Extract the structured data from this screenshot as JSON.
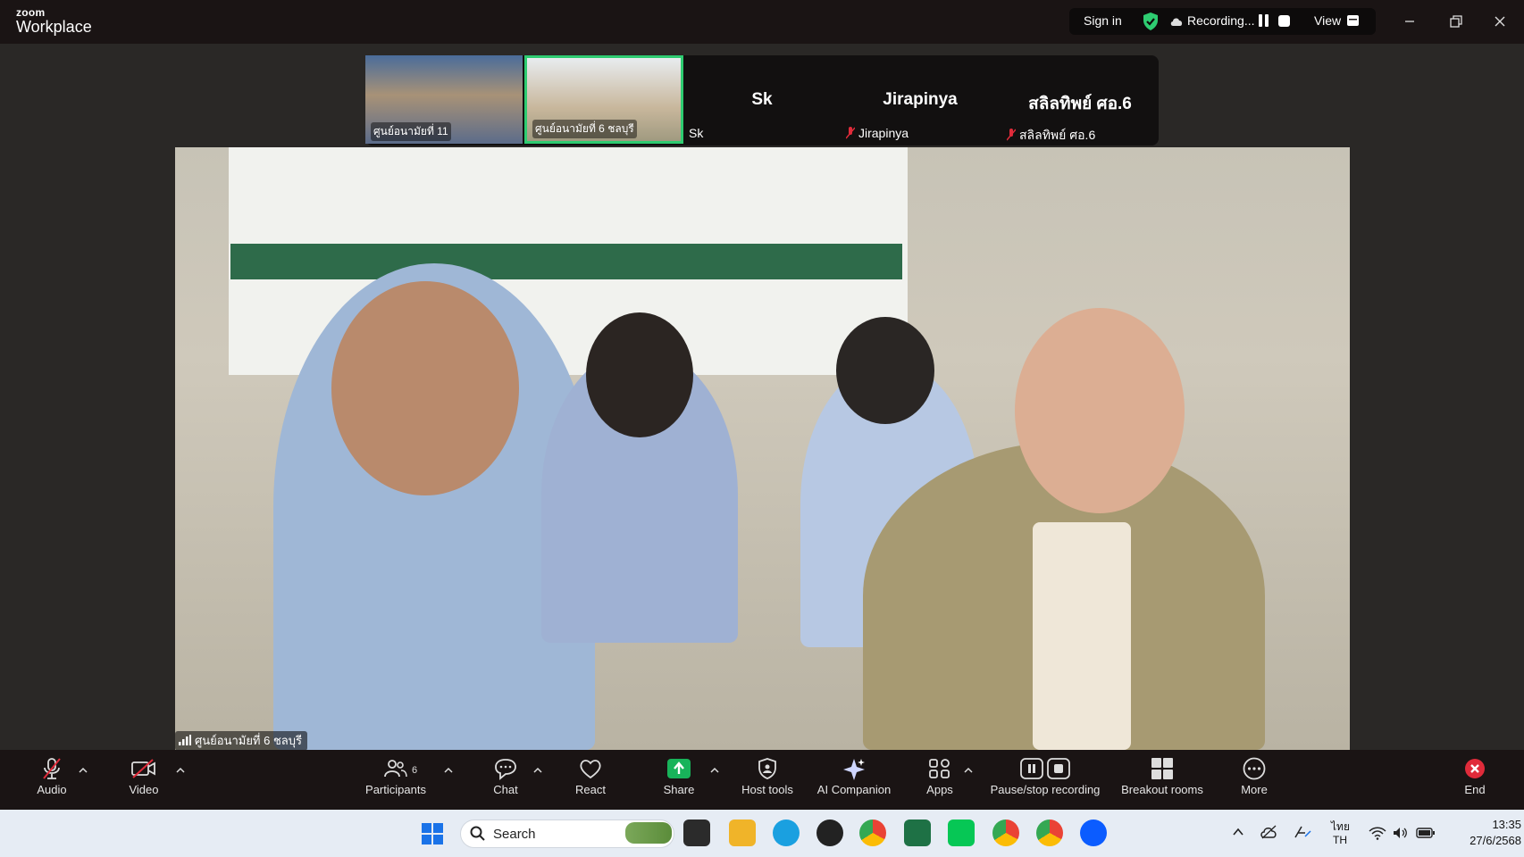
{
  "app": {
    "brand_small": "zoom",
    "brand_big": "Workplace"
  },
  "titlebar": {
    "sign_in": "Sign in",
    "recording": "Recording...",
    "view": "View"
  },
  "strip": {
    "thumbs": [
      {
        "label": "ศูนย์อนามัยที่ 11"
      },
      {
        "label": "ศูนย์อนามัยที่ 6 ชลบุรี"
      }
    ],
    "tiles": [
      {
        "name": "Sk",
        "sub": "Sk"
      },
      {
        "name": "Jirapinya",
        "sub": "Jirapinya"
      },
      {
        "name": "สลิลทิพย์ ศอ.6",
        "sub": "สลิลทิพย์ ศอ.6"
      }
    ]
  },
  "main_video": {
    "speaker_label": "ศูนย์อนามัยที่ 6 ชลบุรี"
  },
  "toolbar": {
    "audio": "Audio",
    "video": "Video",
    "participants": "Participants",
    "participants_count": "6",
    "chat": "Chat",
    "react": "React",
    "share": "Share",
    "host_tools": "Host tools",
    "ai_companion": "AI Companion",
    "apps": "Apps",
    "pause_stop": "Pause/stop recording",
    "breakout": "Breakout rooms",
    "more": "More",
    "end": "End"
  },
  "taskbar": {
    "search": "Search",
    "lang_top": "ไทย",
    "lang_bottom": "TH",
    "time": "13:35",
    "date": "27/6/2568"
  },
  "colors": {
    "accent_green": "#2ecc71",
    "end_red": "#e02b3a",
    "share_green": "#18b35a"
  }
}
